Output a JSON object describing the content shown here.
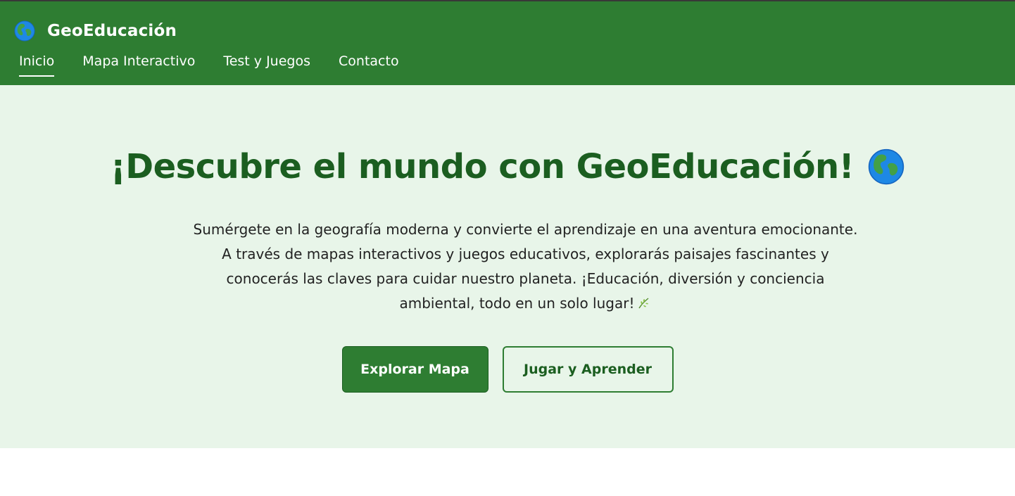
{
  "header": {
    "brand": "GeoEducación",
    "nav": [
      {
        "label": "Inicio",
        "active": true
      },
      {
        "label": "Mapa Interactivo",
        "active": false
      },
      {
        "label": "Test y Juegos",
        "active": false
      },
      {
        "label": "Contacto",
        "active": false
      }
    ]
  },
  "hero": {
    "title": "¡Descubre el mundo con GeoEducación!",
    "description": "Sumérgete en la geografía moderna y convierte el aprendizaje en una aventura emocionante. A través de mapas interactivos y juegos educativos, explorarás paisajes fascinantes y conocerás las claves para cuidar nuestro planeta. ¡Educación, diversión y conciencia ambiental, todo en un solo lugar!",
    "buttons": {
      "primary": "Explorar Mapa",
      "secondary": "Jugar y Aprender"
    }
  },
  "icons": {
    "brand": "globe-icon",
    "title": "globe-icon",
    "description_end": "leaf-icon"
  },
  "colors": {
    "header_bg": "#2e7d32",
    "hero_bg": "#e8f5e9",
    "title": "#1b5e20",
    "primary_button": "#2e7d32"
  }
}
